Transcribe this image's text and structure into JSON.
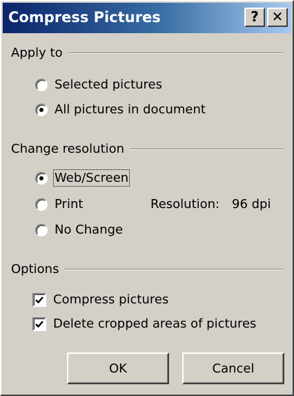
{
  "window": {
    "title": "Compress Pictures",
    "help_label": "?",
    "close_label": "✕"
  },
  "apply_to": {
    "label": "Apply to",
    "options": [
      {
        "label": "Selected pictures",
        "selected": false
      },
      {
        "label": "All pictures in document",
        "selected": true
      }
    ]
  },
  "change_resolution": {
    "label": "Change resolution",
    "options": [
      {
        "label": "Web/Screen",
        "selected": true
      },
      {
        "label": "Print",
        "selected": false
      },
      {
        "label": "No Change",
        "selected": false
      }
    ],
    "resolution_label": "Resolution:",
    "resolution_value": "96 dpi"
  },
  "options": {
    "label": "Options",
    "checkboxes": [
      {
        "label": "Compress pictures",
        "checked": true
      },
      {
        "label": "Delete cropped areas of pictures",
        "checked": true
      }
    ]
  },
  "buttons": {
    "ok": "OK",
    "cancel": "Cancel"
  }
}
